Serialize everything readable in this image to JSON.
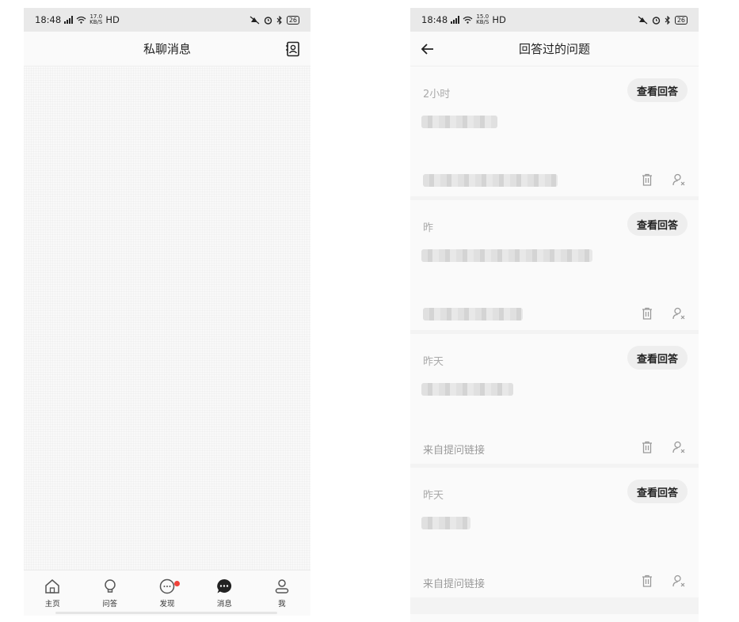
{
  "left": {
    "status": {
      "time": "18:48",
      "signal": "5G",
      "net_speed_value": "17.0",
      "net_speed_unit": "KB/S",
      "hd": "HD",
      "battery": "26"
    },
    "title": "私聊消息",
    "tabs": [
      {
        "label": "主页",
        "icon": "home-icon"
      },
      {
        "label": "问答",
        "icon": "bulb-icon"
      },
      {
        "label": "发现",
        "icon": "discover-icon",
        "badge": true
      },
      {
        "label": "消息",
        "icon": "message-icon",
        "active": true
      },
      {
        "label": "我",
        "icon": "user-icon"
      }
    ]
  },
  "right": {
    "status": {
      "time": "18:48",
      "signal": "5G",
      "net_speed_value": "15.0",
      "net_speed_unit": "KB/S",
      "hd": "HD",
      "battery": "26"
    },
    "title": "回答过的问题",
    "view_label": "查看回答",
    "cards": [
      {
        "time": "2小时",
        "question": "",
        "source": ""
      },
      {
        "time": "昨",
        "question": "",
        "source": ""
      },
      {
        "time": "昨天",
        "question": "",
        "source": "来自提问链接"
      },
      {
        "time": "昨天",
        "question": "",
        "source": "来自提问链接"
      }
    ]
  },
  "colors": {
    "badge": "#f0433a",
    "page_bg": "#fafafa",
    "status_bg": "#e9e9e9"
  }
}
